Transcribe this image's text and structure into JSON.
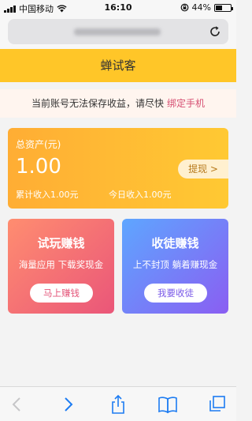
{
  "status_bar": {
    "carrier": "中国移动",
    "time": "16:10",
    "battery": "44%",
    "battery_level": 0.44
  },
  "header": {
    "title": "蝉试客"
  },
  "notice": {
    "text": "当前账号无法保存收益，请尽快",
    "link": "绑定手机"
  },
  "asset": {
    "label": "总资产(元)",
    "amount": "1.00",
    "cumulative": "累计收入1.00元",
    "today": "今日收入1.00元",
    "withdraw": "提现 >"
  },
  "features": {
    "trial": {
      "title": "试玩赚钱",
      "desc": "海量应用 下载奖现金",
      "button": "马上赚钱"
    },
    "invite": {
      "title": "收徒赚钱",
      "desc": "上不封顶 躺着赚现金",
      "button": "我要收徒"
    }
  },
  "toolbar": {
    "icons": [
      "back-icon",
      "forward-icon",
      "share-icon",
      "bookmarks-icon",
      "tabs-icon"
    ]
  },
  "colors": {
    "accent": "#ffc628",
    "link": "#d64f72",
    "browser_blue": "#1d7cf2"
  }
}
